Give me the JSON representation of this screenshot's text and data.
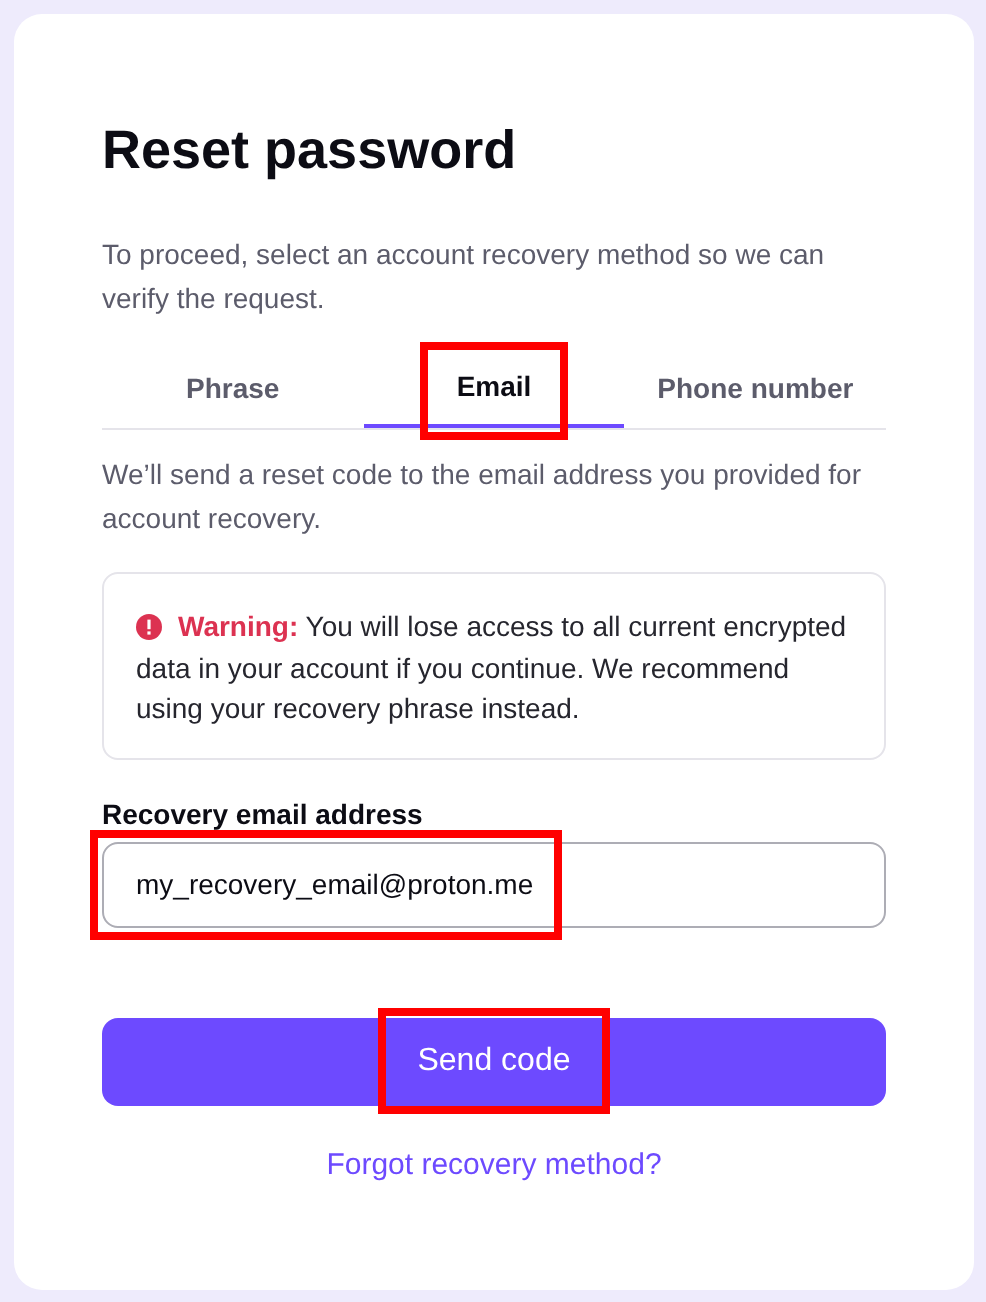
{
  "title": "Reset password",
  "intro": "To proceed, select an account recovery method so we can verify the request.",
  "tabs": [
    {
      "label": "Phrase",
      "selected": false,
      "highlighted": false
    },
    {
      "label": "Email",
      "selected": true,
      "highlighted": true
    },
    {
      "label": "Phone number",
      "selected": false,
      "highlighted": false
    }
  ],
  "description": "We’ll send a reset code to the email address you provided for account recovery.",
  "warning": {
    "text": "**Warning:** You will lose access to all current encrypted data in your account if you continue. We recommend using your recovery phrase instead."
  },
  "email_field": {
    "label": "Recovery email address",
    "value": "my_recovery_email@proton.me",
    "highlighted": true
  },
  "submit_button": {
    "label": "Send code",
    "highlighted": true
  },
  "link": "Forgot recovery method?"
}
